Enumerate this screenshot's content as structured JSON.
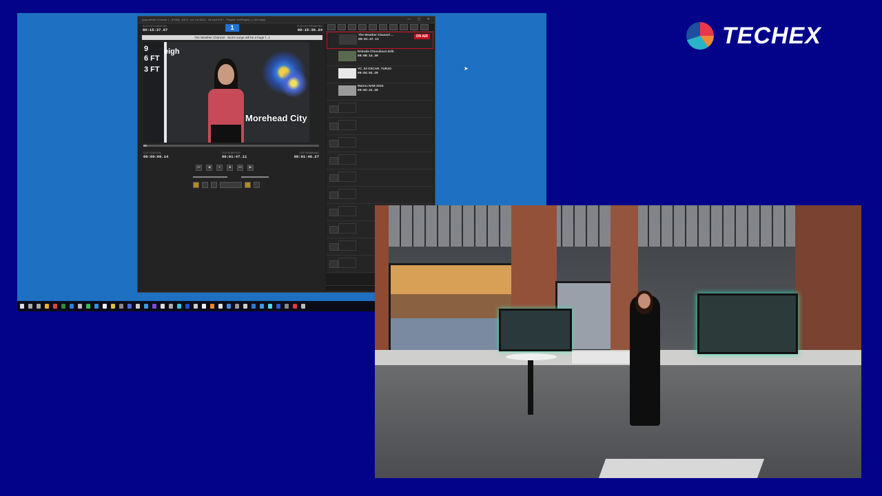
{
  "brand": {
    "name": "TECHEX"
  },
  "window": {
    "title": "playoutHub Channel 1 - [PGM] - [NIT] - ver 3.6.6114 - 18 sept 2017 - Playlist: testPlaylist_1 (3/3 clips)"
  },
  "player": {
    "channel_number": "1",
    "playlist_duration_label": "PLAYLIST DURATION",
    "playlist_duration": "00:15:37.07",
    "playlist_remaining_label": "PLAYLIST REMAINING",
    "playlist_remaining": "00:15:36.24",
    "current_clip_title": "The Weather Channel · Storm surge will be a huge f...1",
    "preview_city_label": "Morehead City",
    "preview_map_fragment": "eigh",
    "preview_ft": [
      "9",
      "6 FT",
      "3 FT"
    ],
    "clip_position_label": "CLIP POSITION",
    "clip_position": "00:00:00.14",
    "clip_duration_label": "CLIP DURATION",
    "clip_duration": "00:01:47.11",
    "clip_remaining_label": "CLIP REMAINING",
    "clip_remaining": "00:01:46.27",
    "progress_fraction": 0.01
  },
  "playlist": {
    "items": [
      {
        "name": "The Weather Channel ...",
        "duration": "00:01:47.11",
        "onair": true,
        "badge": "ON AIR"
      },
      {
        "name": "Entrada Chucubuco Edit",
        "duration": "00:08:14.30",
        "onair": false
      },
      {
        "name": "VC_03 OSCAR_TURJO",
        "duration": "00:04:52.26",
        "onair": false
      },
      {
        "name": "Matrox NAB 2016-",
        "duration": "00:02:41.30",
        "onair": false
      }
    ],
    "empty_slot_count": 10
  },
  "colors": {
    "desktop": "#1e70c2",
    "background": "#03038a",
    "onair": "#c1121c",
    "channel_badge": "#1f73d8"
  }
}
